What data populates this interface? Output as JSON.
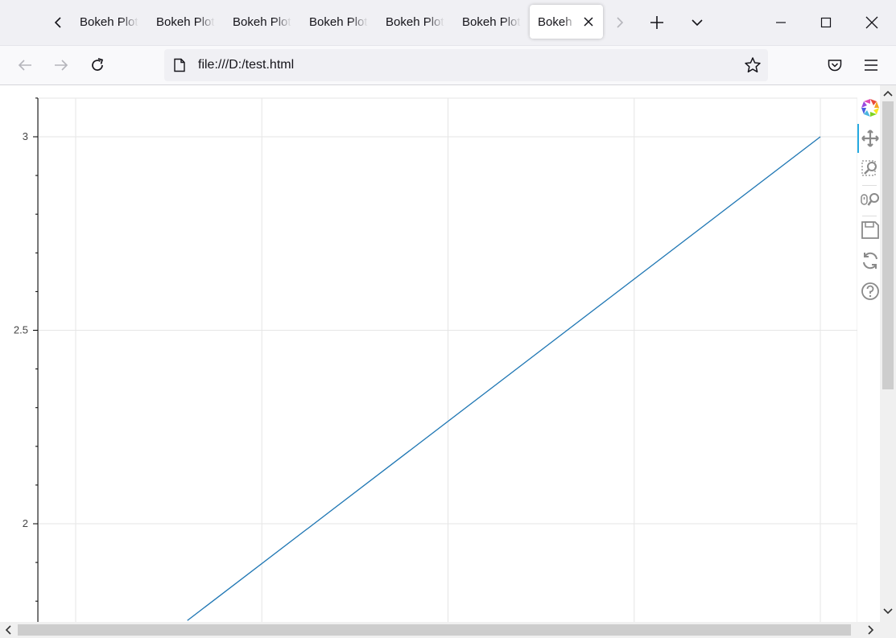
{
  "browser": {
    "tabs": [
      {
        "label": "Bokeh Plot"
      },
      {
        "label": "Bokeh Plot"
      },
      {
        "label": "Bokeh Plot"
      },
      {
        "label": "Bokeh Plot"
      },
      {
        "label": "Bokeh Plot"
      },
      {
        "label": "Bokeh Plot"
      },
      {
        "label": "Bokeh Plot",
        "active": true
      }
    ],
    "url": "file:///D:/test.html"
  },
  "toolbar": {
    "tools": [
      "bokeh-logo-icon",
      "pan-icon",
      "box-zoom-icon",
      "wheel-zoom-icon",
      "save-icon",
      "reset-icon",
      "help-icon"
    ]
  },
  "chart_data": {
    "type": "line",
    "series": [
      {
        "x": [
          1.6,
          5
        ],
        "y": [
          1.75,
          3
        ],
        "color": "#1f77b4"
      }
    ],
    "y_ticks": [
      "3",
      "2.5",
      "2"
    ],
    "y_tick_values": [
      3,
      2.5,
      2
    ],
    "ylim": [
      1.75,
      3.1
    ],
    "xlim": [
      0.8,
      5.2
    ],
    "x_grid": [
      1,
      2,
      3,
      4,
      5
    ],
    "grid": true
  }
}
